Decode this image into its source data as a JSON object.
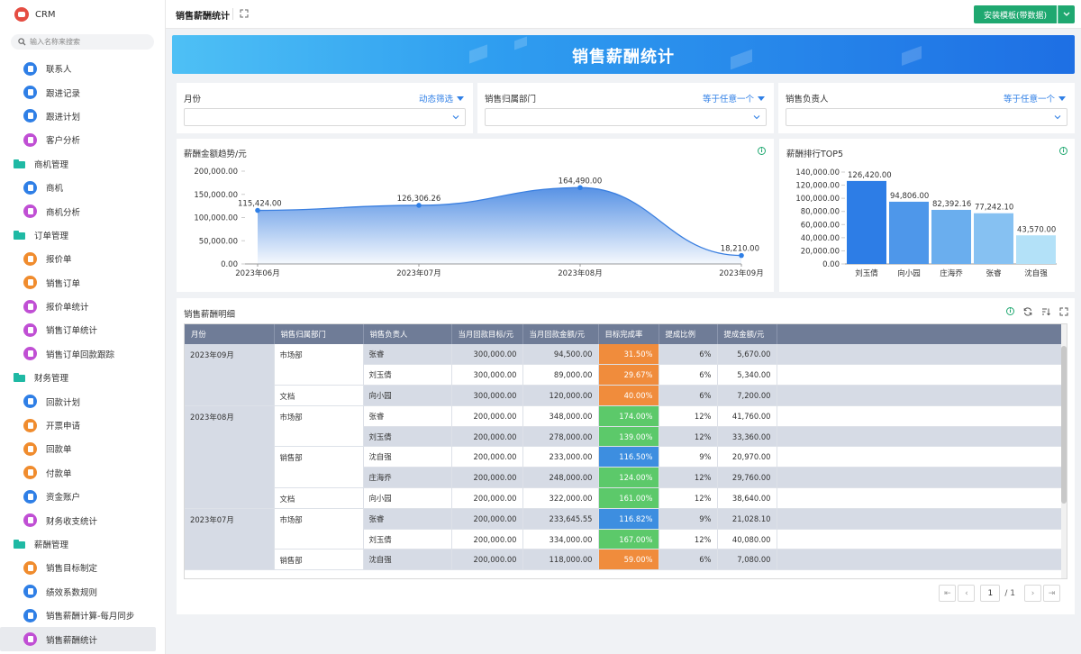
{
  "app": {
    "name": "CRM"
  },
  "search": {
    "placeholder": "输入名称来搜索"
  },
  "nav": [
    {
      "type": "item",
      "label": "联系人",
      "color": "#2f7fe6"
    },
    {
      "type": "item",
      "label": "跟进记录",
      "color": "#2f7fe6"
    },
    {
      "type": "item",
      "label": "跟进计划",
      "color": "#2f7fe6"
    },
    {
      "type": "item",
      "label": "客户分析",
      "color": "#c04fd4"
    },
    {
      "type": "group",
      "label": "商机管理"
    },
    {
      "type": "item",
      "label": "商机",
      "color": "#2f7fe6"
    },
    {
      "type": "item",
      "label": "商机分析",
      "color": "#c04fd4"
    },
    {
      "type": "group",
      "label": "订单管理"
    },
    {
      "type": "item",
      "label": "报价单",
      "color": "#f08c2e"
    },
    {
      "type": "item",
      "label": "销售订单",
      "color": "#f08c2e"
    },
    {
      "type": "item",
      "label": "报价单统计",
      "color": "#c04fd4"
    },
    {
      "type": "item",
      "label": "销售订单统计",
      "color": "#c04fd4"
    },
    {
      "type": "item",
      "label": "销售订单回款跟踪",
      "color": "#c04fd4"
    },
    {
      "type": "group",
      "label": "财务管理"
    },
    {
      "type": "item",
      "label": "回款计划",
      "color": "#2f7fe6"
    },
    {
      "type": "item",
      "label": "开票申请",
      "color": "#f08c2e"
    },
    {
      "type": "item",
      "label": "回款单",
      "color": "#f08c2e"
    },
    {
      "type": "item",
      "label": "付款单",
      "color": "#f08c2e"
    },
    {
      "type": "item",
      "label": "资金账户",
      "color": "#2f7fe6"
    },
    {
      "type": "item",
      "label": "财务收支统计",
      "color": "#c04fd4"
    },
    {
      "type": "group",
      "label": "薪酬管理"
    },
    {
      "type": "item",
      "label": "销售目标制定",
      "color": "#f08c2e"
    },
    {
      "type": "item",
      "label": "绩效系数规则",
      "color": "#2f7fe6"
    },
    {
      "type": "item",
      "label": "销售薪酬计算-每月同步",
      "color": "#2f7fe6"
    },
    {
      "type": "item",
      "label": "销售薪酬统计",
      "color": "#c04fd4",
      "active": true
    }
  ],
  "header": {
    "title": "销售薪酬统计",
    "install_label": "安装模板(带数据)"
  },
  "banner": {
    "title": "销售薪酬统计"
  },
  "filters": [
    {
      "label": "月份",
      "mode": "动态筛选"
    },
    {
      "label": "销售归属部门",
      "mode": "等于任意一个"
    },
    {
      "label": "销售负责人",
      "mode": "等于任意一个"
    }
  ],
  "trend": {
    "title": "薪酬金额趋势/元"
  },
  "top5": {
    "title": "薪酬排行TOP5"
  },
  "chart_data": [
    {
      "type": "area",
      "title": "薪酬金额趋势/元",
      "x": [
        "2023年06月",
        "2023年07月",
        "2023年08月",
        "2023年09月"
      ],
      "values": [
        115424.0,
        126306.26,
        164490.0,
        18210.0
      ],
      "value_labels": [
        "115,424.00",
        "126,306.26",
        "164,490.00",
        "18,210.00"
      ],
      "yticks": [
        "0.00",
        "50,000.00",
        "100,000.00",
        "150,000.00",
        "200,000.00"
      ],
      "ylim": [
        0,
        200000
      ],
      "color": "#3a7fe0"
    },
    {
      "type": "bar",
      "title": "薪酬排行TOP5",
      "categories": [
        "刘玉倩",
        "向小园",
        "庄海乔",
        "张睿",
        "沈自强"
      ],
      "values": [
        126420.0,
        94806.0,
        82392.16,
        77242.1,
        43570.0
      ],
      "value_labels": [
        "126,420.00",
        "94,806.00",
        "82,392.16",
        "77,242.10",
        "43,570.00"
      ],
      "yticks": [
        "0.00",
        "20,000.00",
        "40,000.00",
        "60,000.00",
        "80,000.00",
        "100,000.00",
        "120,000.00",
        "140,000.00"
      ],
      "ylim": [
        0,
        140000
      ],
      "colors": [
        "#2d7de6",
        "#4e97ea",
        "#6aaeee",
        "#86c1f2",
        "#b3e1f8"
      ]
    }
  ],
  "detail": {
    "title": "销售薪酬明细",
    "columns": [
      "月份",
      "销售归属部门",
      "销售负责人",
      "当月回款目标/元",
      "当月回款金额/元",
      "目标完成率",
      "提成比例",
      "提成金额/元"
    ],
    "rows": [
      {
        "month": "2023年09月",
        "dept": "市场部",
        "person": "张睿",
        "target": "300,000.00",
        "amount": "94,500.00",
        "rate": "31.50%",
        "rate_color": "#f08c3c",
        "ratio": "6%",
        "commission": "5,670.00"
      },
      {
        "month": "",
        "dept": "",
        "person": "刘玉倩",
        "target": "300,000.00",
        "amount": "89,000.00",
        "rate": "29.67%",
        "rate_color": "#f08c3c",
        "ratio": "6%",
        "commission": "5,340.00"
      },
      {
        "month": "",
        "dept": "文档",
        "person": "向小园",
        "target": "300,000.00",
        "amount": "120,000.00",
        "rate": "40.00%",
        "rate_color": "#f08c3c",
        "ratio": "6%",
        "commission": "7,200.00"
      },
      {
        "month": "2023年08月",
        "dept": "市场部",
        "person": "张睿",
        "target": "200,000.00",
        "amount": "348,000.00",
        "rate": "174.00%",
        "rate_color": "#5cc96a",
        "ratio": "12%",
        "commission": "41,760.00"
      },
      {
        "month": "",
        "dept": "",
        "person": "刘玉倩",
        "target": "200,000.00",
        "amount": "278,000.00",
        "rate": "139.00%",
        "rate_color": "#5cc96a",
        "ratio": "12%",
        "commission": "33,360.00"
      },
      {
        "month": "",
        "dept": "销售部",
        "person": "沈自强",
        "target": "200,000.00",
        "amount": "233,000.00",
        "rate": "116.50%",
        "rate_color": "#3d8ee0",
        "ratio": "9%",
        "commission": "20,970.00"
      },
      {
        "month": "",
        "dept": "",
        "person": "庄海乔",
        "target": "200,000.00",
        "amount": "248,000.00",
        "rate": "124.00%",
        "rate_color": "#5cc96a",
        "ratio": "12%",
        "commission": "29,760.00"
      },
      {
        "month": "",
        "dept": "文档",
        "person": "向小园",
        "target": "200,000.00",
        "amount": "322,000.00",
        "rate": "161.00%",
        "rate_color": "#5cc96a",
        "ratio": "12%",
        "commission": "38,640.00"
      },
      {
        "month": "2023年07月",
        "dept": "市场部",
        "person": "张睿",
        "target": "200,000.00",
        "amount": "233,645.55",
        "rate": "116.82%",
        "rate_color": "#3d8ee0",
        "ratio": "9%",
        "commission": "21,028.10"
      },
      {
        "month": "",
        "dept": "",
        "person": "刘玉倩",
        "target": "200,000.00",
        "amount": "334,000.00",
        "rate": "167.00%",
        "rate_color": "#5cc96a",
        "ratio": "12%",
        "commission": "40,080.00"
      },
      {
        "month": "",
        "dept": "销售部",
        "person": "沈自强",
        "target": "200,000.00",
        "amount": "118,000.00",
        "rate": "59.00%",
        "rate_color": "#f08c3c",
        "ratio": "6%",
        "commission": "7,080.00"
      }
    ]
  },
  "pager": {
    "page": "1",
    "total": "/ 1"
  }
}
